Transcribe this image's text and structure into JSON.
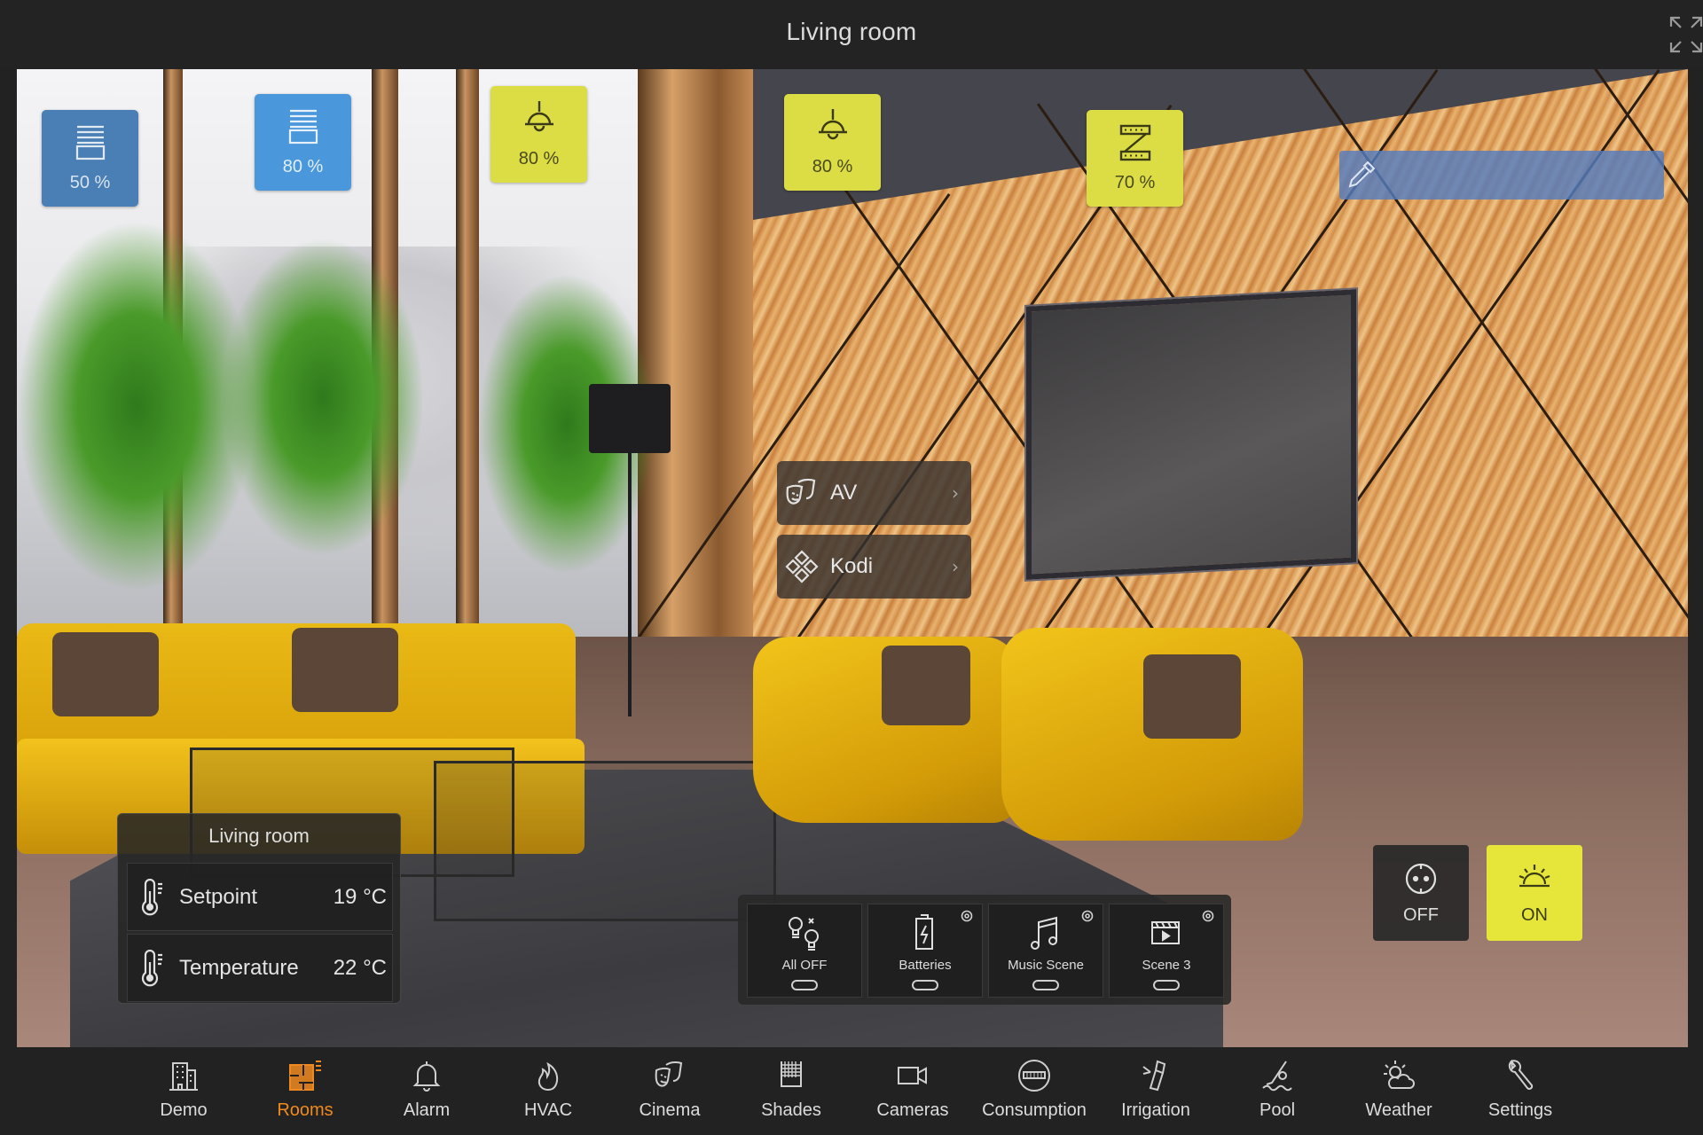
{
  "header": {
    "title": "Living room",
    "fullscreen_icon": "expand-icon"
  },
  "tiles": [
    {
      "id": "shade-1",
      "icon": "window-shade-icon",
      "value": "50 %",
      "state": "blue-dark"
    },
    {
      "id": "shade-2",
      "icon": "window-shade-icon",
      "value": "80 %",
      "state": "blue"
    },
    {
      "id": "light-1",
      "icon": "pendant-lamp-icon",
      "value": "80 %",
      "state": "yellow"
    },
    {
      "id": "light-2",
      "icon": "pendant-lamp-icon",
      "value": "80 %",
      "state": "yellow"
    },
    {
      "id": "led-strip",
      "icon": "led-strip-icon",
      "value": "70 %",
      "state": "yellow"
    }
  ],
  "color_picker": {
    "icon": "eyedropper-icon",
    "color": "#547cbe"
  },
  "menus": [
    {
      "label": "AV",
      "icon": "theater-masks-icon"
    },
    {
      "label": "Kodi",
      "icon": "kodi-icon"
    }
  ],
  "climate": {
    "title": "Living room",
    "rows": [
      {
        "label": "Setpoint",
        "value": "19 °C",
        "icon": "thermometer-icon"
      },
      {
        "label": "Temperature",
        "value": "22 °C",
        "icon": "thermometer-icon"
      }
    ]
  },
  "scenes": [
    {
      "label": "All OFF",
      "icon": "lightbulbs-off-icon",
      "has_settings": false
    },
    {
      "label": "Batteries",
      "icon": "battery-icon",
      "has_settings": true
    },
    {
      "label": "Music Scene",
      "icon": "music-note-icon",
      "has_settings": true
    },
    {
      "label": "Scene 3",
      "icon": "clapperboard-icon",
      "has_settings": true
    }
  ],
  "switch": {
    "off_label": "OFF",
    "on_label": "ON",
    "active": "ON"
  },
  "colors": {
    "accent": "#f08a1e",
    "active_tile": "#dcdc45",
    "shade_tile": "#4a98db",
    "shade_tile_dark": "#4a7fb5",
    "background": "#222222"
  },
  "nav": {
    "active": "Rooms",
    "items": [
      {
        "label": "Demo",
        "icon": "building-icon"
      },
      {
        "label": "Rooms",
        "icon": "floorplan-icon"
      },
      {
        "label": "Alarm",
        "icon": "bell-icon"
      },
      {
        "label": "HVAC",
        "icon": "flame-icon"
      },
      {
        "label": "Cinema",
        "icon": "theater-masks-icon"
      },
      {
        "label": "Shades",
        "icon": "shades-icon"
      },
      {
        "label": "Cameras",
        "icon": "video-camera-icon"
      },
      {
        "label": "Consumption",
        "icon": "meter-icon"
      },
      {
        "label": "Irrigation",
        "icon": "sprinkler-icon"
      },
      {
        "label": "Pool",
        "icon": "swimmer-icon"
      },
      {
        "label": "Weather",
        "icon": "sun-cloud-icon"
      },
      {
        "label": "Settings",
        "icon": "wrench-icon"
      }
    ]
  }
}
